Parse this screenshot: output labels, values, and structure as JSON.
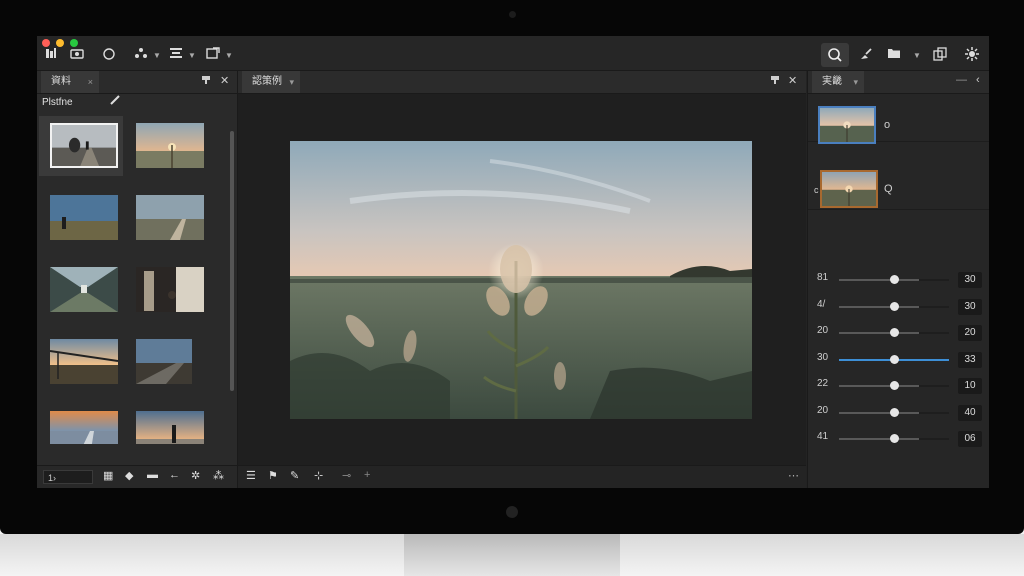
{
  "titlebar": {
    "icons": [
      "library-icon",
      "camera-icon",
      "circle-icon",
      "people-icon",
      "layout-icon",
      "export-icon",
      "search-icon",
      "brush-icon",
      "folder-icon",
      "copy-icon",
      "settings-icon"
    ]
  },
  "left_panel": {
    "tab_label": "資料",
    "tab_close": "×",
    "header_close": "✕",
    "section_label": "Plstfne",
    "thumbnails": [
      {
        "scene": "figure-path",
        "selected": true
      },
      {
        "scene": "sunset-plant"
      },
      {
        "scene": "figure-field-sky"
      },
      {
        "scene": "road-horizon"
      },
      {
        "scene": "tunnel-light"
      },
      {
        "scene": "doorway-person"
      },
      {
        "scene": "pier-sunset"
      },
      {
        "scene": "street-dusk"
      },
      {
        "scene": "beach-orange"
      },
      {
        "scene": "figure-shore"
      }
    ],
    "bottom_bar": {
      "field_value": "1›"
    }
  },
  "center_panel": {
    "tab_label": "認策例",
    "tab_caret": "▾",
    "header_close": "✕",
    "bottom_right": "⋯"
  },
  "right_panel": {
    "tab_label": "実畿",
    "tab_caret": "▾",
    "header_minimize": "—",
    "header_collapse": "‹",
    "preview_icons": [
      "o",
      "Q"
    ],
    "preview_side_label": "c",
    "sliders": [
      {
        "label": "81",
        "value": "30",
        "level": 0.5
      },
      {
        "label": "4/",
        "value": "30",
        "level": 0.5
      },
      {
        "label": "20",
        "value": "20",
        "level": 0.5
      },
      {
        "label": "30",
        "value": "33",
        "level": 0.5,
        "accent": true
      },
      {
        "label": "22",
        "value": "10",
        "level": 0.5
      },
      {
        "label": "20",
        "value": "40",
        "level": 0.5
      },
      {
        "label": "41",
        "value": "06",
        "level": 0.5
      }
    ]
  },
  "colors": {
    "bezel": "#060606",
    "panel": "#2a2a2a",
    "accent": "#3d8fd6",
    "selection": "#4a7fbf",
    "preview2_border": "#a8692f"
  }
}
